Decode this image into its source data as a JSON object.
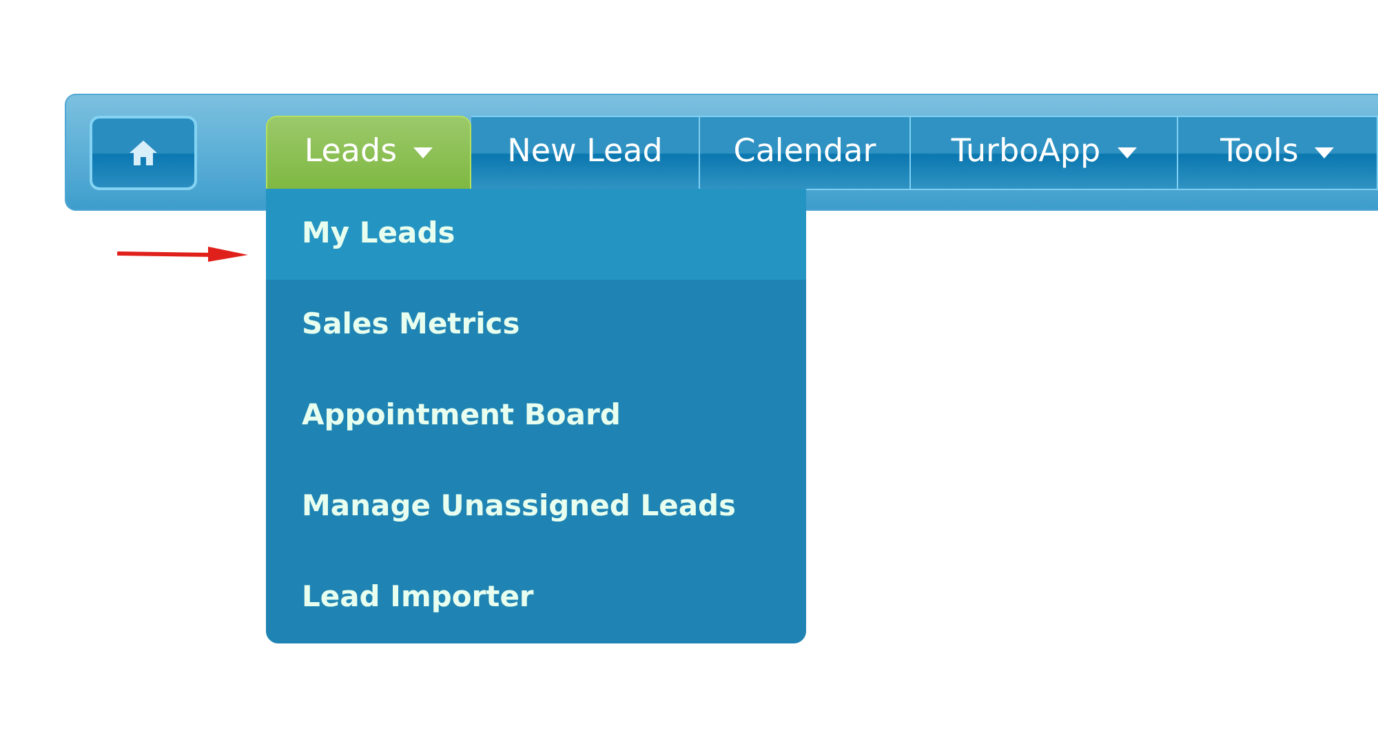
{
  "nav": {
    "tabs": [
      {
        "label": "Leads",
        "dropdown": true,
        "selected": true
      },
      {
        "label": "New Lead",
        "dropdown": false,
        "selected": false
      },
      {
        "label": "Calendar",
        "dropdown": false,
        "selected": false
      },
      {
        "label": "TurboApp",
        "dropdown": true,
        "selected": false
      },
      {
        "label": "Tools",
        "dropdown": true,
        "selected": false
      }
    ]
  },
  "dropdown_menu": {
    "items": [
      {
        "label": "My Leads",
        "highlighted": true
      },
      {
        "label": "Sales Metrics",
        "highlighted": false
      },
      {
        "label": "Appointment Board",
        "highlighted": false
      },
      {
        "label": "Manage Unassigned Leads",
        "highlighted": false
      },
      {
        "label": "Lead Importer",
        "highlighted": false
      }
    ]
  },
  "annotation": {
    "arrow": true
  }
}
